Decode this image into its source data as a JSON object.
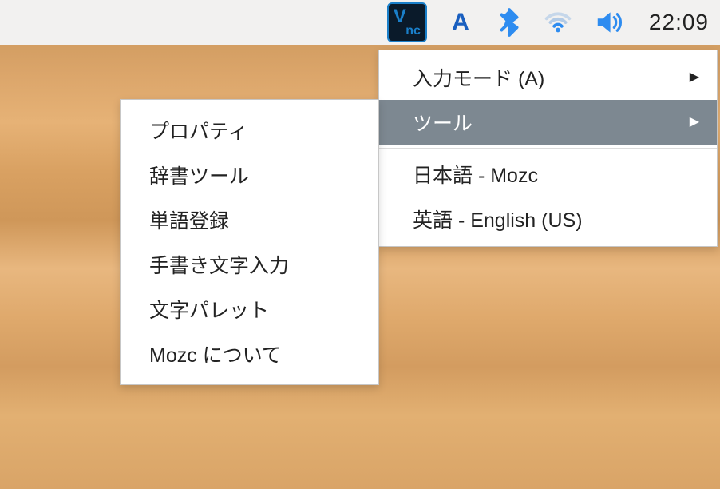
{
  "taskbar": {
    "vnc_label": "Vnc",
    "ime_letter": "A",
    "clock": "22:09"
  },
  "main_menu": {
    "items": [
      {
        "label": "入力モード (A)",
        "has_submenu": true
      },
      {
        "label": "ツール",
        "has_submenu": true,
        "highlighted": true
      },
      {
        "label": "日本語 - Mozc",
        "has_submenu": false
      },
      {
        "label": "英語 - English (US)",
        "has_submenu": false
      }
    ]
  },
  "sub_menu": {
    "items": [
      {
        "label": "プロパティ"
      },
      {
        "label": "辞書ツール"
      },
      {
        "label": "単語登録"
      },
      {
        "label": "手書き文字入力"
      },
      {
        "label": "文字パレット"
      },
      {
        "label": "Mozc について"
      }
    ]
  }
}
